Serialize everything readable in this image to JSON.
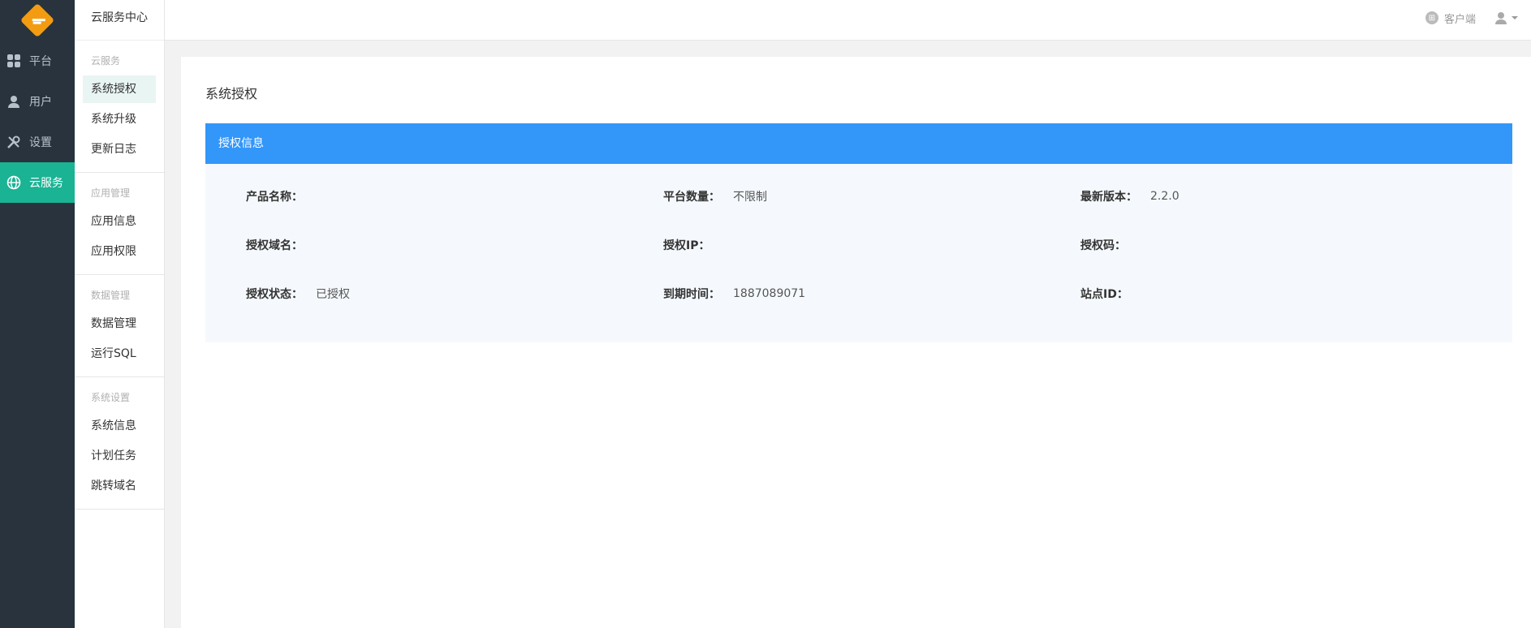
{
  "rail": {
    "items": [
      {
        "label": "平台",
        "icon": "grid-icon"
      },
      {
        "label": "用户",
        "icon": "user-icon"
      },
      {
        "label": "设置",
        "icon": "tools-icon"
      },
      {
        "label": "云服务",
        "icon": "globe-icon"
      }
    ],
    "active_index": 3
  },
  "subnav": {
    "title": "云服务中心",
    "groups": [
      {
        "title": "云服务",
        "items": [
          "系统授权",
          "系统升级",
          "更新日志"
        ]
      },
      {
        "title": "应用管理",
        "items": [
          "应用信息",
          "应用权限"
        ]
      },
      {
        "title": "数据管理",
        "items": [
          "数据管理",
          "运行SQL"
        ]
      },
      {
        "title": "系统设置",
        "items": [
          "系统信息",
          "计划任务",
          "跳转域名"
        ]
      }
    ],
    "active_item": "系统授权"
  },
  "topbar": {
    "client_label": "客户端"
  },
  "main": {
    "page_title": "系统授权",
    "panel_title": "授权信息",
    "fields": [
      [
        {
          "label": "产品名称：",
          "value": ""
        },
        {
          "label": "平台数量：",
          "value": "不限制"
        },
        {
          "label": "最新版本：",
          "value": "2.2.0"
        }
      ],
      [
        {
          "label": "授权域名：",
          "value": ""
        },
        {
          "label": "授权IP：",
          "value": ""
        },
        {
          "label": "授权码：",
          "value": ""
        }
      ],
      [
        {
          "label": "授权状态：",
          "value": "已授权"
        },
        {
          "label": "到期时间：",
          "value": "1887089071"
        },
        {
          "label": "站点ID：",
          "value": ""
        }
      ]
    ]
  },
  "colors": {
    "rail_bg": "#28333e",
    "rail_active": "#1ab394",
    "panel_header": "#3396f9",
    "logo": "#f39c12"
  }
}
